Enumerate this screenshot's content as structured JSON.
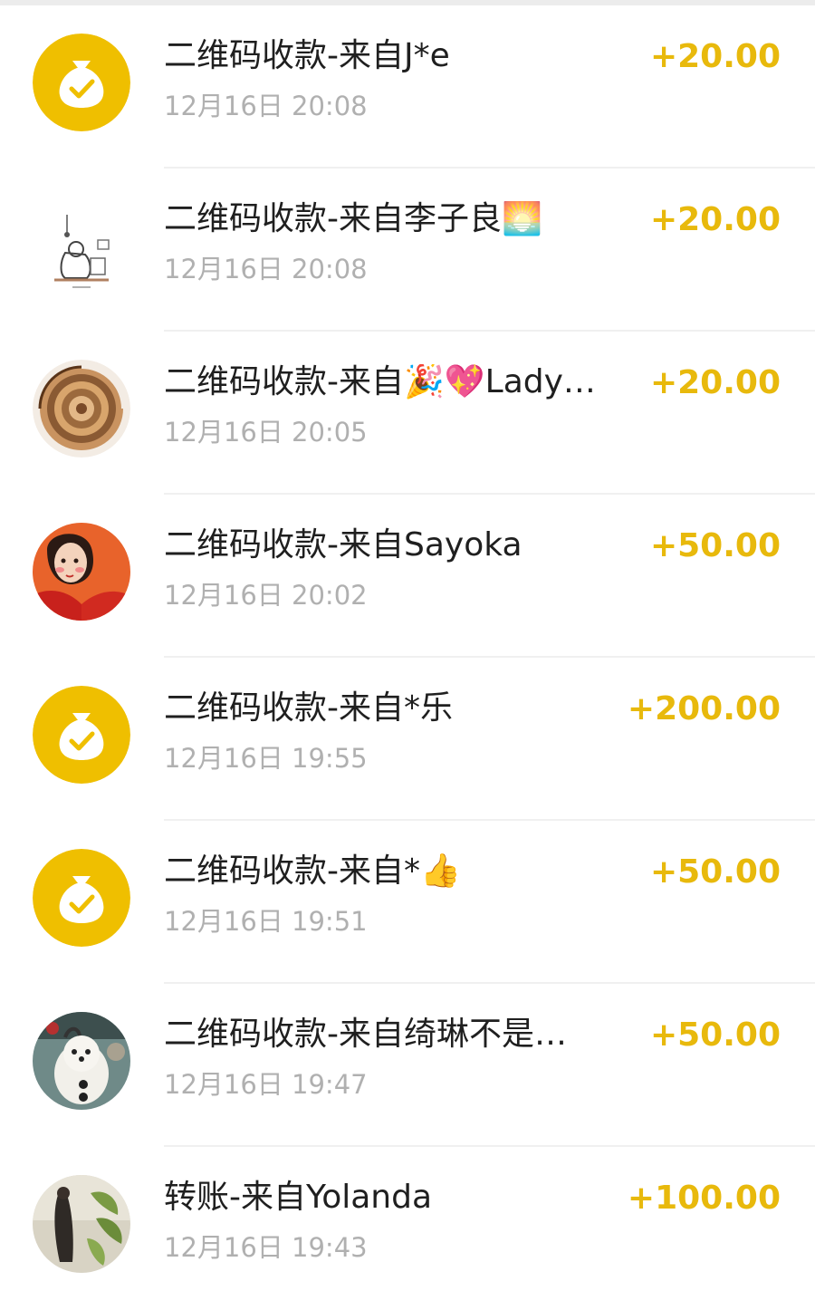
{
  "colors": {
    "amount": "#e8b90c",
    "brand_yellow": "#efbf00",
    "title": "#1f1f1f",
    "time": "#b0b0b0",
    "divider": "#f0f0f0"
  },
  "transactions": [
    {
      "title": "二维码收款-来自J*e",
      "time": "12月16日 20:08",
      "amount": "+20.00",
      "avatar": "money-bag-icon"
    },
    {
      "title": "二维码收款-来自李子良🌅",
      "time": "12月16日 20:08",
      "amount": "+20.00",
      "avatar": "sketch-photo"
    },
    {
      "title": "二维码收款-来自🎉💖Lady…",
      "time": "12月16日 20:05",
      "amount": "+20.00",
      "avatar": "spiral-photo"
    },
    {
      "title": "二维码收款-来自Sayoka",
      "time": "12月16日 20:02",
      "amount": "+50.00",
      "avatar": "illustrated-girl-photo"
    },
    {
      "title": "二维码收款-来自*乐",
      "time": "12月16日 19:55",
      "amount": "+200.00",
      "avatar": "money-bag-icon"
    },
    {
      "title": "二维码收款-来自*👍",
      "time": "12月16日 19:51",
      "amount": "+50.00",
      "avatar": "money-bag-icon"
    },
    {
      "title": "二维码收款-来自绮琳不是…",
      "time": "12月16日 19:47",
      "amount": "+50.00",
      "avatar": "dog-photo"
    },
    {
      "title": "转账-来自Yolanda",
      "time": "12月16日 19:43",
      "amount": "+100.00",
      "avatar": "plant-photo"
    }
  ]
}
